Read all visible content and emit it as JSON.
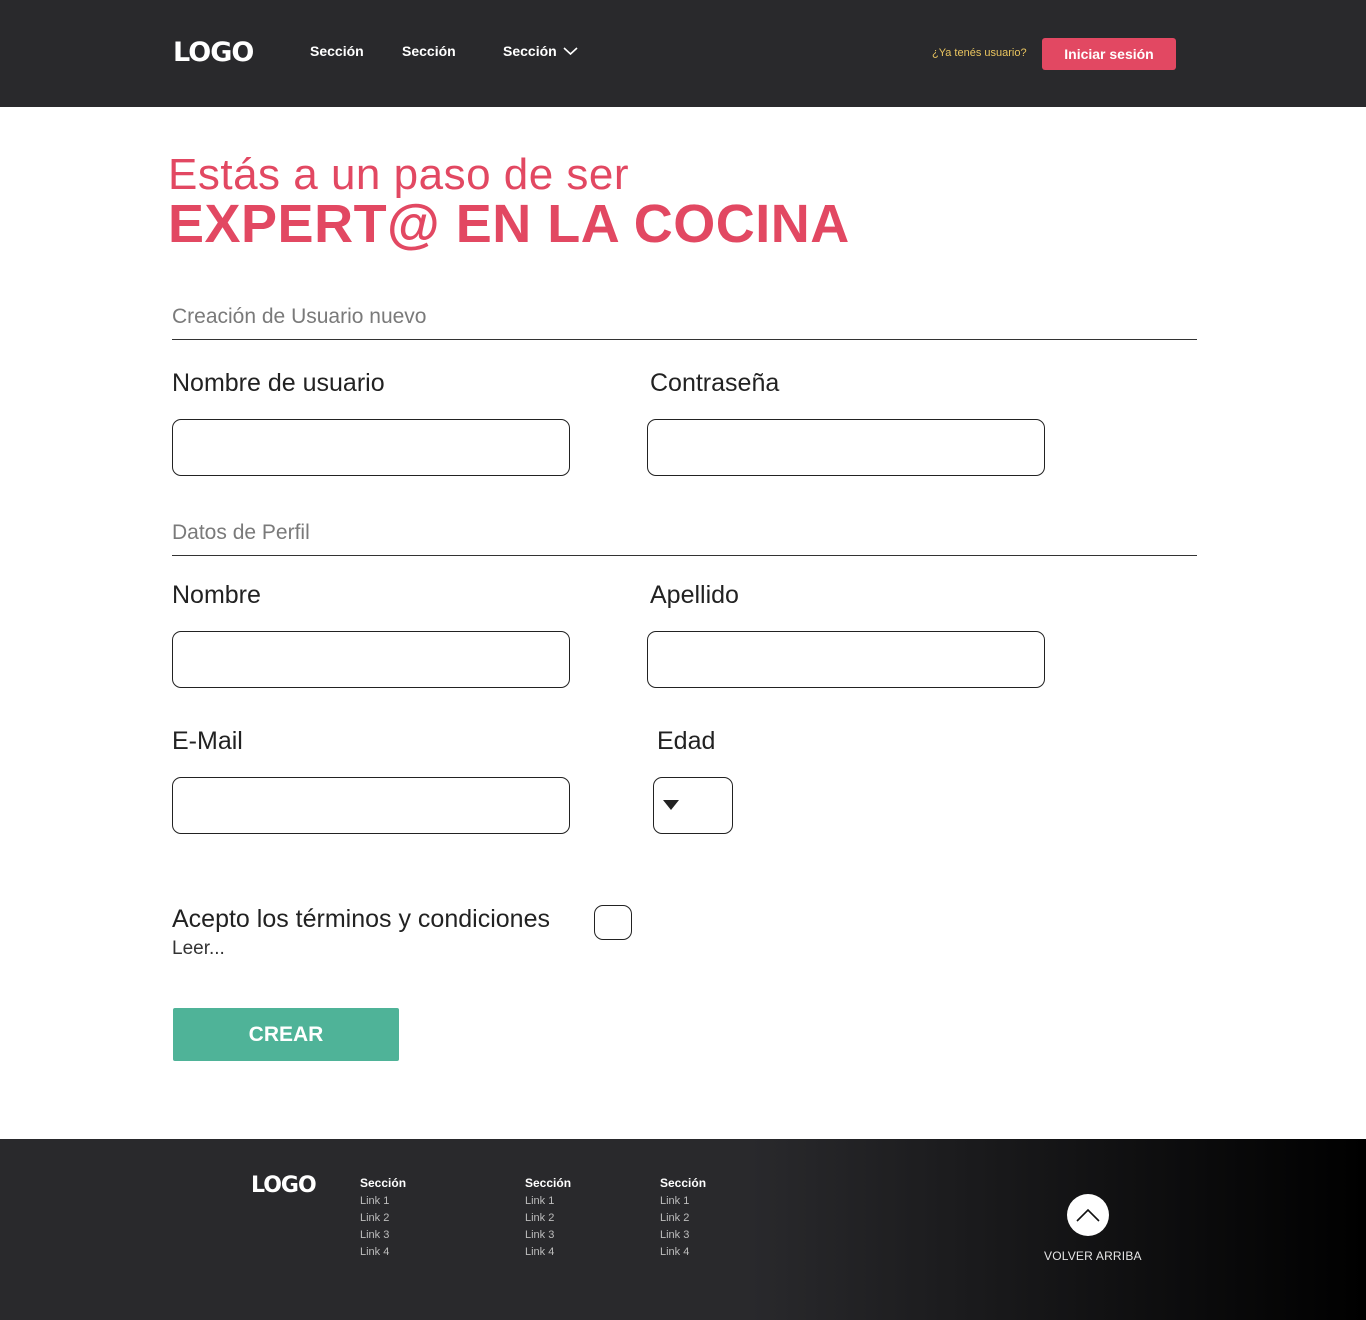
{
  "header": {
    "logo": "LOGO",
    "nav": [
      {
        "label": "Sección"
      },
      {
        "label": "Sección"
      },
      {
        "label": "Sección"
      }
    ],
    "have_user_text": "¿Ya tenés usuario?",
    "login_label": "Iniciar sesión"
  },
  "hero": {
    "line1": "Estás a un paso de ser",
    "line2": "EXPERT@ EN LA COCINA"
  },
  "form": {
    "section_user": "Creación de Usuario nuevo",
    "username_label": "Nombre de usuario",
    "username_value": "",
    "password_label": "Contraseña",
    "password_value": "",
    "section_profile": "Datos de Perfil",
    "name_label": "Nombre",
    "name_value": "",
    "lastname_label": "Apellido",
    "lastname_value": "",
    "email_label": "E-Mail",
    "email_value": "",
    "age_label": "Edad",
    "age_value": "",
    "terms_label": "Acepto los términos y condiciones",
    "terms_checked": false,
    "read_link": "Leer...",
    "submit_label": "CREAR"
  },
  "footer": {
    "logo": "LOGO",
    "columns": [
      {
        "title": "Sección",
        "links": [
          "Link 1",
          "Link 2",
          "Link 3",
          "Link 4"
        ]
      },
      {
        "title": "Sección",
        "links": [
          "Link 1",
          "Link 2",
          "Link 3",
          "Link 4"
        ]
      },
      {
        "title": "Sección",
        "links": [
          "Link 1",
          "Link 2",
          "Link 3",
          "Link 4"
        ]
      }
    ],
    "back_to_top": "VOLVER ARRIBA"
  },
  "colors": {
    "header_bg": "#29292c",
    "accent_pink": "#e24862",
    "accent_yellow": "#e9c45f",
    "button_green": "#4fb398"
  },
  "icons": {
    "nav_dropdown": "chevron-down-icon",
    "age_select": "caret-down-icon",
    "back_to_top": "chevron-up-icon"
  }
}
